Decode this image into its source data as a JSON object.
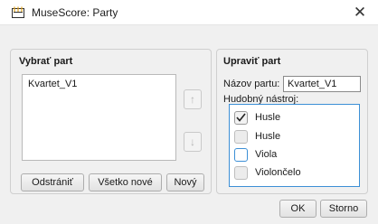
{
  "window": {
    "title": "MuseScore: Party",
    "close_symbol": "✕"
  },
  "left_group": {
    "title": "Vybrať part",
    "parts": [
      "Kvartet_V1"
    ],
    "buttons": {
      "remove": "Odstrániť",
      "all_new": "Všetko nové",
      "new": "Nový"
    }
  },
  "right_group": {
    "title": "Upraviť part",
    "name_label": "Názov partu:",
    "name_value": "Kvartet_V1",
    "instrument_label": "Hudobný nástroj:",
    "instruments": [
      {
        "label": "Husle",
        "checked": true
      },
      {
        "label": "Husle",
        "checked": false
      },
      {
        "label": "Viola",
        "checked": false
      },
      {
        "label": "Violončelo",
        "checked": false
      }
    ]
  },
  "footer": {
    "ok": "OK",
    "cancel": "Storno"
  },
  "colors": {
    "focus": "#3c8fd6",
    "background": "#f0f0f0"
  }
}
